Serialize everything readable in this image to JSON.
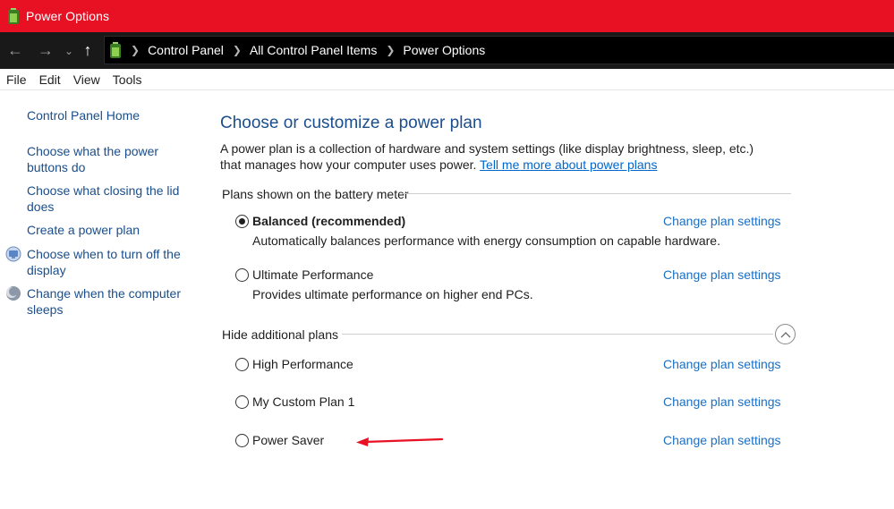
{
  "window": {
    "title": "Power Options",
    "title_bar_color": "#e81123"
  },
  "addressbar": {
    "back_icon": "back-arrow-icon",
    "forward_icon": "forward-arrow-icon",
    "recent_icon": "chevron-down-icon",
    "up_icon": "up-arrow-icon",
    "breadcrumbs": [
      "Control Panel",
      "All Control Panel Items",
      "Power Options"
    ]
  },
  "menubar": {
    "items": [
      "File",
      "Edit",
      "View",
      "Tools"
    ]
  },
  "sidebar": {
    "items": [
      {
        "label": "Control Panel Home",
        "icon": null
      },
      {
        "label": "Choose what the power buttons do",
        "icon": null
      },
      {
        "label": "Choose what closing the lid does",
        "icon": null
      },
      {
        "label": "Create a power plan",
        "icon": null
      },
      {
        "label": "Choose when to turn off the display",
        "icon": "display-icon"
      },
      {
        "label": "Change when the computer sleeps",
        "icon": "moon-icon"
      }
    ]
  },
  "main": {
    "heading": "Choose or customize a power plan",
    "description": "A power plan is a collection of hardware and system settings (like display brightness, sleep, etc.) that manages how your computer uses power.",
    "description_link": "Tell me more about power plans",
    "battery_group": {
      "label": "Plans shown on the battery meter",
      "plans": [
        {
          "name": "Balanced (recommended)",
          "description": "Automatically balances performance with energy consumption on capable hardware.",
          "selected": true,
          "link": "Change plan settings"
        },
        {
          "name": "Ultimate Performance",
          "description": "Provides ultimate performance on higher end PCs.",
          "selected": false,
          "link": "Change plan settings"
        }
      ]
    },
    "additional_group": {
      "label": "Hide additional plans",
      "collapse_icon": "chevron-up-icon",
      "plans": [
        {
          "name": "High Performance",
          "selected": false,
          "link": "Change plan settings"
        },
        {
          "name": "My Custom Plan 1",
          "selected": false,
          "link": "Change plan settings"
        },
        {
          "name": "Power Saver",
          "selected": false,
          "link": "Change plan settings"
        }
      ]
    },
    "annotation_arrow_color": "#e81123"
  }
}
